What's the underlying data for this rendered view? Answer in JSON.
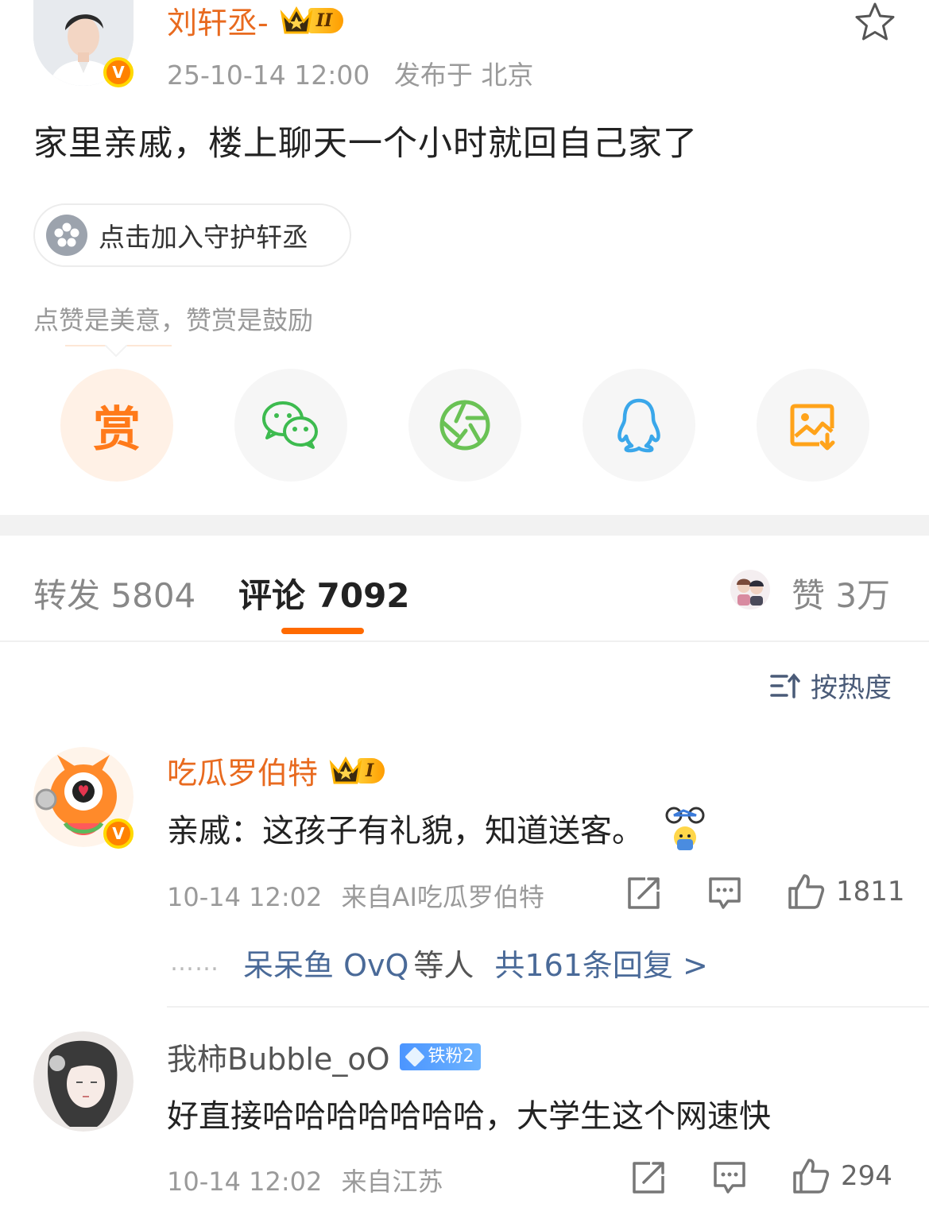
{
  "post": {
    "author_name": "刘轩丞-",
    "author_rank": "II",
    "timestamp": "25-10-14 12:00",
    "location_prefix": "发布于",
    "location": "北京",
    "text": "家里亲戚，楼上聊天一个小时就回自己家了",
    "guard_button_label": "点击加入守护轩丞",
    "reward_hint": "点赞是美意，赞赏是鼓励",
    "reward_label": "赏"
  },
  "share_targets": [
    {
      "name": "reward",
      "icon": "reward-icon"
    },
    {
      "name": "wechat",
      "icon": "wechat-icon"
    },
    {
      "name": "moments",
      "icon": "moments-icon"
    },
    {
      "name": "qq",
      "icon": "qq-icon"
    },
    {
      "name": "save-image",
      "icon": "save-image-icon"
    }
  ],
  "tabs": {
    "repost_label": "转发",
    "repost_count": "5804",
    "comment_label": "评论",
    "comment_count": "7092",
    "like_label": "赞",
    "like_count": "3万"
  },
  "sort": {
    "label": "按热度"
  },
  "comments": [
    {
      "name": "吃瓜罗伯特",
      "rank": "I",
      "text": "亲戚：这孩子有礼貌，知道送客。",
      "time": "10-14 12:02",
      "source": "来自AI吃瓜罗伯特",
      "likes": "1811",
      "reply_dots": "……",
      "reply_users": "呆呆鱼 OvQ",
      "reply_connector": "等人",
      "reply_total": "共161条回复 >"
    },
    {
      "name": "我柿Bubble_oO",
      "fan_badge": "铁粉2",
      "text": "好直接哈哈哈哈哈哈哈，大学生这个网速快",
      "time": "10-14 12:02",
      "source": "来自江苏",
      "likes": "294"
    }
  ],
  "colors": {
    "accent_orange": "#ff6a00",
    "vip_name": "#e86a1f",
    "link_blue": "#4a6a98",
    "wechat_green": "#3dbb4f",
    "qq_blue": "#3aa7ea",
    "save_orange": "#ffa31a"
  }
}
